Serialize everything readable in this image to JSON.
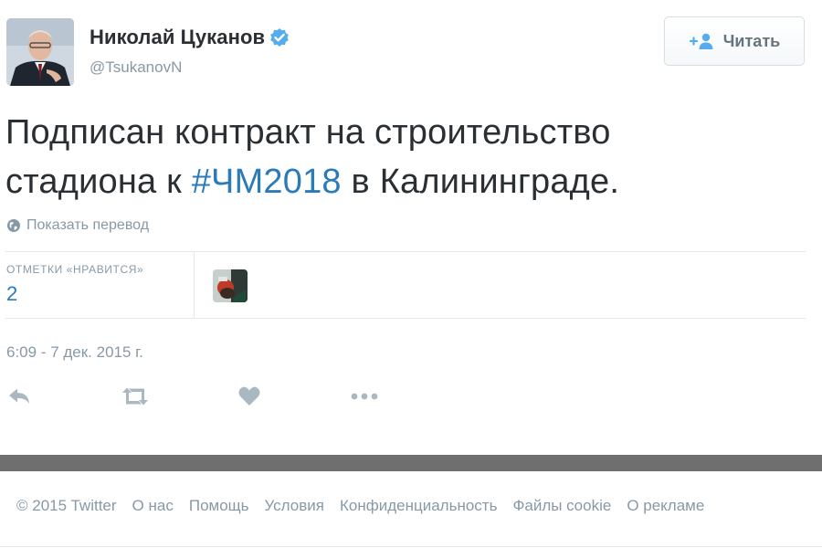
{
  "tweet": {
    "display_name": "Николай Цуканов",
    "handle": "@TsukanovN",
    "follow_label": "Читать",
    "text_part1": "Подписан контракт на строительство",
    "text_part2": "стадиона к",
    "hashtag": "#ЧМ2018",
    "text_part3": "в Калининграде.",
    "translate_label": "Показать перевод",
    "likes_label": "ОТМЕТКИ «НРАВИТСЯ»",
    "likes_count": "2",
    "timestamp": "6:09 - 7 дек. 2015 г."
  },
  "icons": {
    "verified": "verified-badge-icon",
    "follow": "add-user-icon",
    "translate": "globe-icon",
    "reply": "reply-icon",
    "retweet": "retweet-icon",
    "like": "heart-icon",
    "more": "more-dots-icon"
  },
  "footer": {
    "copyright": "© 2015 Twitter",
    "links": [
      "О нас",
      "Помощь",
      "Условия",
      "Конфиденциальность",
      "Файлы cookie",
      "О рекламе"
    ]
  },
  "colors": {
    "link_blue": "#2b7bb9",
    "verified_blue": "#55acee",
    "muted_gray": "#8899a6",
    "icon_gray": "#aab8c2",
    "text_dark": "#292f33",
    "footer_bar": "#6f6f6f"
  }
}
